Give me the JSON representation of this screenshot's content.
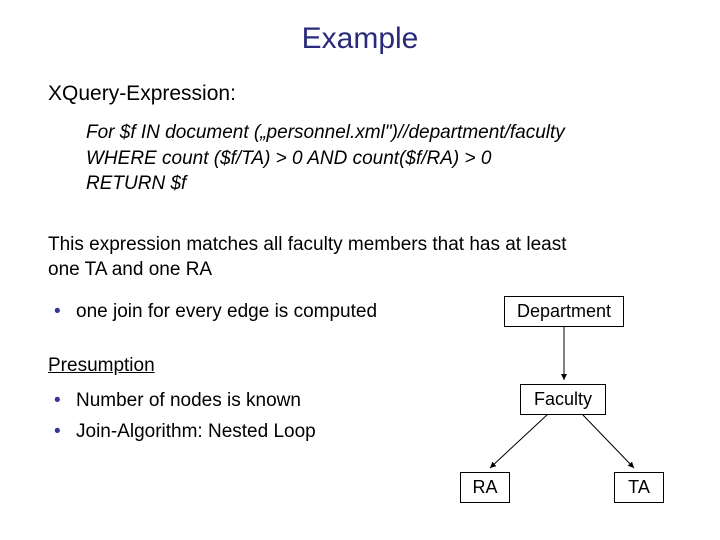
{
  "title": "Example",
  "section_label": "XQuery-Expression:",
  "code": {
    "line1": "For $f IN document („personnel.xml\")//department/faculty",
    "line2": "WHERE count ($f/TA) > 0 AND count($f/RA) > 0",
    "line3": "RETURN $f"
  },
  "description": "This expression matches all faculty members that has at least one TA and one RA",
  "bullet_top": "one join for every edge is computed",
  "presumption_heading": "Presumption",
  "bullets_bottom": [
    "Number of nodes is known",
    "Join-Algorithm: Nested Loop"
  ],
  "diagram": {
    "department": "Department",
    "faculty": "Faculty",
    "ra": "RA",
    "ta": "TA"
  }
}
